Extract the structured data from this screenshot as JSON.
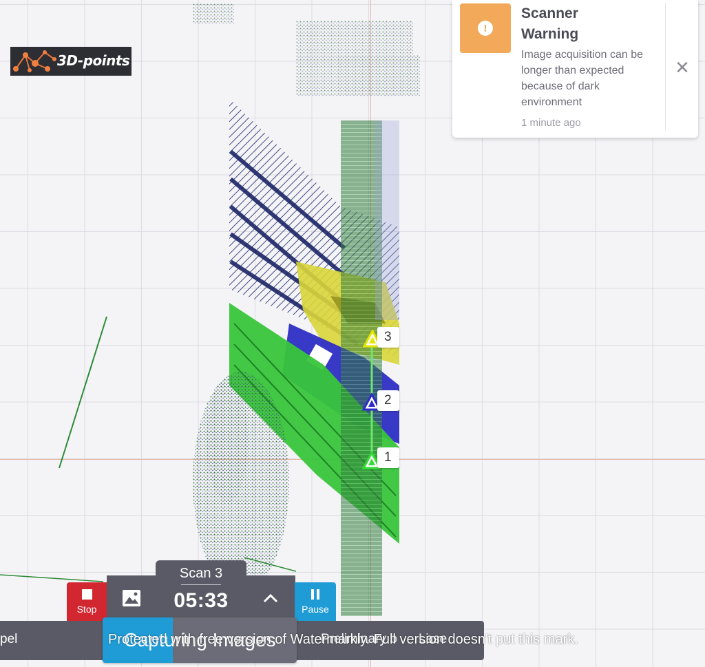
{
  "logo": {
    "text": "3D-points"
  },
  "toast": {
    "title": "Scanner Warning",
    "message": "Image acquisition can be longer than expected because of dark environment",
    "time": "1 minute ago",
    "close_icon": "close-icon",
    "accent_color": "#f2a95a"
  },
  "markers": [
    {
      "label": "3",
      "color": "#e6e600"
    },
    {
      "label": "2",
      "color": "#2c2cc8"
    },
    {
      "label": "1",
      "color": "#33dd33"
    }
  ],
  "controls": {
    "stop_label": "Stop",
    "scan_name": "Scan 3",
    "scan_time": "05:33",
    "pause_label": "Pause",
    "image_icon": "image-icon",
    "chevron_icon": "chevron-up-icon"
  },
  "status": {
    "left_text": "pel",
    "progress_text": "Capturing Images",
    "progress_fraction": 0.36,
    "right_text": "Preliminary b",
    "right_text2": "Lase",
    "watermark": "Protected with free version of Watermarkly. Full version doesn't put this mark."
  },
  "colors": {
    "stop": "#d22630",
    "pause": "#1f9bd6",
    "control_bg": "#5a5a66"
  }
}
